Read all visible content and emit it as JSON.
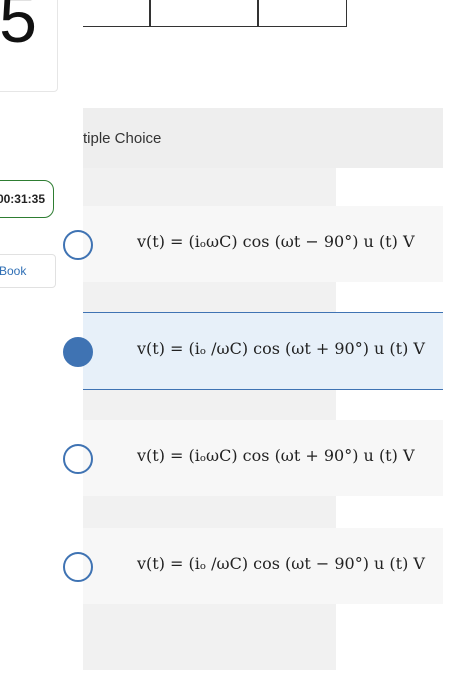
{
  "sidebar": {
    "question_number": "5",
    "timer": "00:31:35",
    "ebook_label": "Book"
  },
  "question": {
    "type_label": "tiple Choice",
    "options": [
      {
        "label": "v(t) = (iₒωC) cos (ωt − 90°) u (t) V",
        "selected": false
      },
      {
        "label": "v(t) = (iₒ /ωC) cos (ωt + 90°) u (t) V",
        "selected": true
      },
      {
        "label": "v(t) = (iₒωC) cos (ωt + 90°) u (t) V",
        "selected": false
      },
      {
        "label": "v(t) = (iₒ /ωC) cos (ωt − 90°) u (t) V",
        "selected": false
      }
    ]
  },
  "colors": {
    "accent": "#3f73b3",
    "timer_border": "#2e7d32",
    "selected_bg": "#e7f0f9"
  }
}
